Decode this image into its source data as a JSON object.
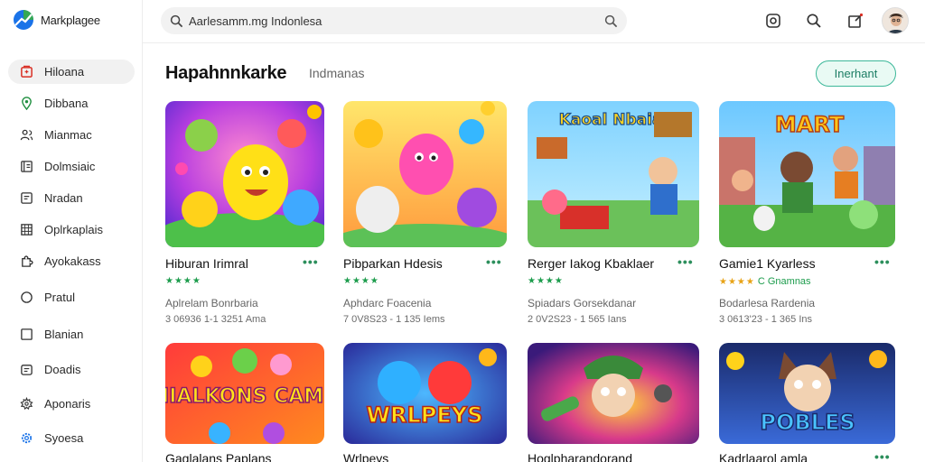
{
  "app": {
    "title": "Markplagee"
  },
  "search": {
    "placeholder": "Aarlesamm.mg Indonlesa"
  },
  "sidebar": {
    "items": [
      {
        "label": "Hiloana",
        "icon": "store-icon",
        "active": true
      },
      {
        "label": "Dibbana",
        "icon": "location-pin-icon",
        "active": false
      },
      {
        "label": "Mianmac",
        "icon": "people-icon",
        "active": false
      },
      {
        "label": "Dolmsiaic",
        "icon": "library-icon",
        "active": false
      },
      {
        "label": "Nradan",
        "icon": "square-icon",
        "active": false
      },
      {
        "label": "Oplrkaplais",
        "icon": "grid-icon",
        "active": false
      },
      {
        "label": "Ayokakass",
        "icon": "puzzle-icon",
        "active": false
      },
      {
        "label": "Pratul",
        "icon": "circle-icon",
        "active": false
      },
      {
        "label": "Blanian",
        "icon": "box-icon",
        "active": false
      },
      {
        "label": "Doadis",
        "icon": "folder-icon",
        "active": false
      },
      {
        "label": "Aponaris",
        "icon": "settings-icon",
        "active": false
      },
      {
        "label": "Syoesa",
        "icon": "gear-icon",
        "active": false
      }
    ]
  },
  "topbar": {
    "icons": [
      "camera-icon",
      "search-icon",
      "edit-icon",
      "avatar"
    ]
  },
  "main": {
    "title": "Hapahnnkarke",
    "subtitle": "Indmanas",
    "action_label": "Inerhant"
  },
  "cards": [
    {
      "title": "Hiburan Irimral",
      "rating": 4,
      "rating_text": "",
      "rating_color": "green",
      "developer": "Aplrelam Bonrbaria",
      "meta": "3 06936 1-1 3251 Ama",
      "more": "•••"
    },
    {
      "title": "Pibparkan Hdesis",
      "rating": 4,
      "rating_text": "",
      "rating_color": "green",
      "developer": "Aphdarc Foacenia",
      "meta": "7 0V8S23 - 1 135 Iems",
      "more": "•••"
    },
    {
      "title": "Rerger Iakog Kbaklaer",
      "rating": 4,
      "rating_text": "",
      "rating_color": "green",
      "developer": "Spiadars Gorsekdanar",
      "meta": "2 0V2S23 - 1 565 Ians",
      "more": "•••"
    },
    {
      "title": "Gamie1 Kyarless",
      "rating": 4,
      "rating_text": "C Gnamnas",
      "rating_color": "gold",
      "developer": "Bodarlesa Rardenia",
      "meta": "3 0613'23 - 1 365 Ins",
      "more": "•••"
    },
    {
      "title": "Gaglalans Paplans",
      "more": "•••",
      "banner": "HIALKONS CAME"
    },
    {
      "title": "Wrlpeys",
      "more": "•••",
      "banner": "WRLPEYS"
    },
    {
      "title": "Hoglpharandorand",
      "more": "•••",
      "banner": ""
    },
    {
      "title": "Kadrlaarol amla",
      "more": "•••",
      "banner": "POBLES"
    }
  ],
  "thumb_banners": {
    "card2": "Kaoal Nbaial",
    "card3": "MART"
  },
  "colors": {
    "accent": "#3db89a",
    "star_green": "#1c9c4c",
    "star_gold": "#e8a317"
  }
}
